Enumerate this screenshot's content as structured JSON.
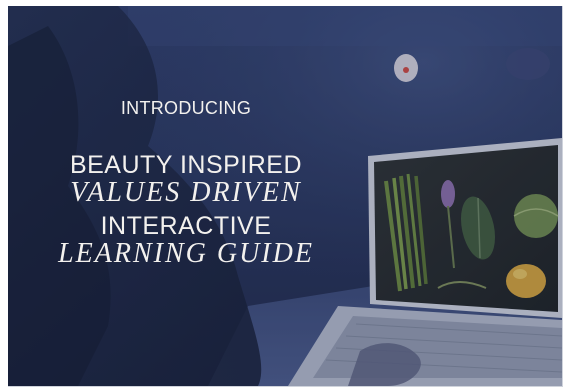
{
  "promo": {
    "kicker": "INTRODUCING",
    "headline_lines": [
      "BEAUTY INSPIRED",
      "VALUES DRIVEN",
      "INTERACTIVE",
      "LEARNING GUIDE"
    ]
  },
  "scene": {
    "subject": "person-at-laptop",
    "screen_content": "botanicals-photo"
  },
  "colors": {
    "overlay": "#27345a",
    "text": "#f3f1ee",
    "frame": "#ffffff"
  }
}
